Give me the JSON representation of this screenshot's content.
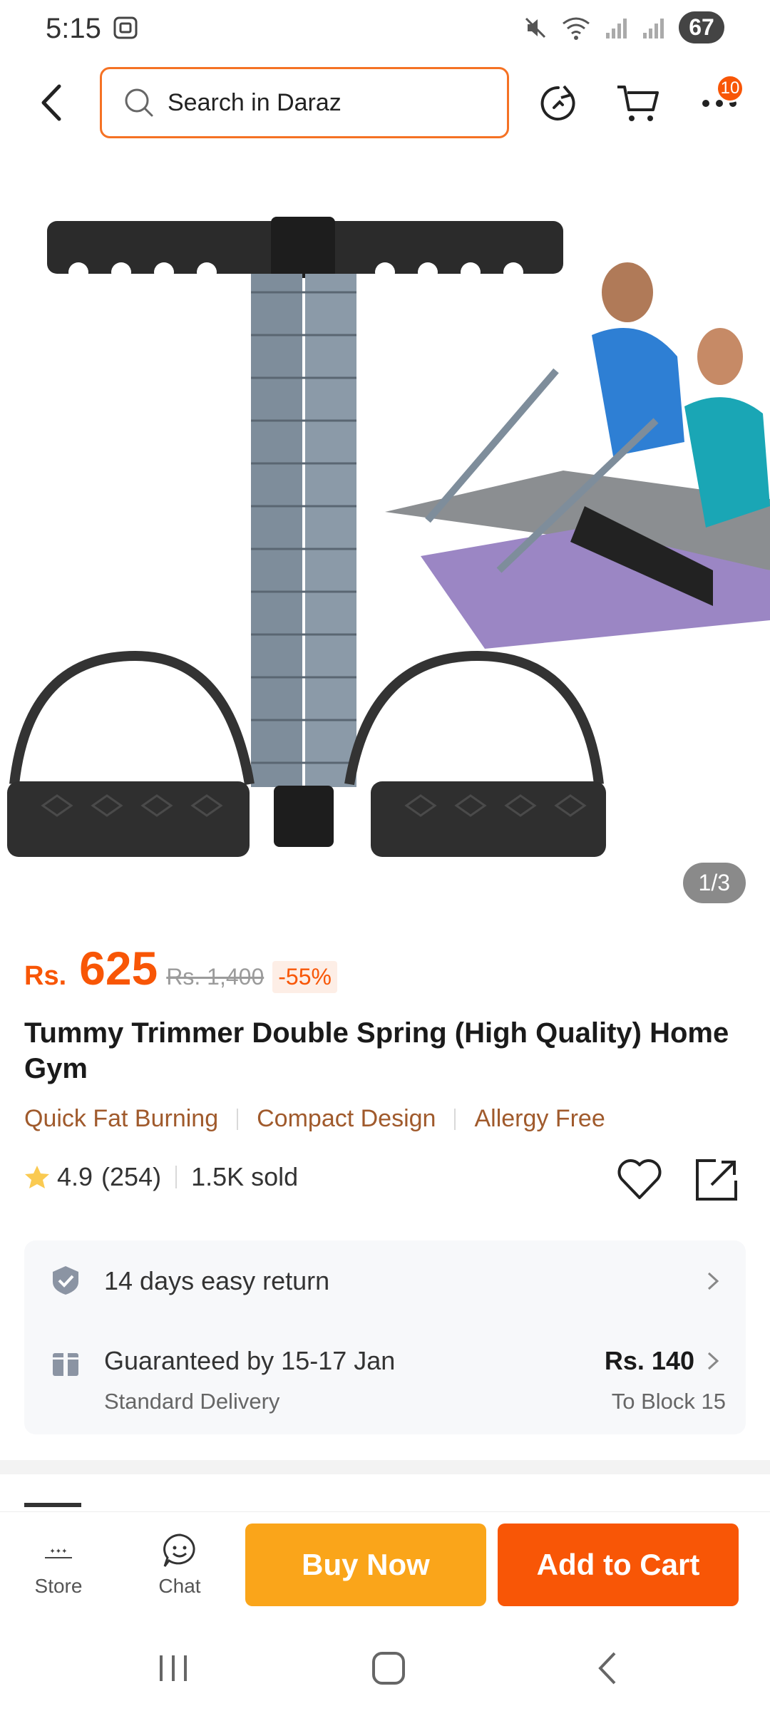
{
  "status_bar": {
    "time": "5:15",
    "battery": "67"
  },
  "header": {
    "search_placeholder": "Search in Daraz",
    "cart_badge": "10"
  },
  "gallery": {
    "pager": "1/3"
  },
  "price": {
    "currency": "Rs.",
    "current": "625",
    "original": "Rs. 1,400",
    "discount": "-55%"
  },
  "product": {
    "title": "Tummy Trimmer Double Spring (High Quality) Home Gym",
    "tags": [
      "Quick Fat Burning",
      "Compact Design",
      "Allergy Free"
    ],
    "rating": "4.9",
    "reviews": "(254)",
    "sold": "1.5K sold"
  },
  "services": {
    "return_label": "14 days easy return",
    "delivery_label": "Guaranteed by 15-17 Jan",
    "delivery_type": "Standard Delivery",
    "delivery_fee": "Rs. 140",
    "delivery_to": "To Block 15"
  },
  "bottom_bar": {
    "store_label": "Store",
    "chat_label": "Chat",
    "buy_now": "Buy Now",
    "add_to_cart": "Add to Cart"
  },
  "colors": {
    "accent": "#f85606",
    "buy_now": "#faa51a",
    "tag_text": "#a05a2c"
  }
}
